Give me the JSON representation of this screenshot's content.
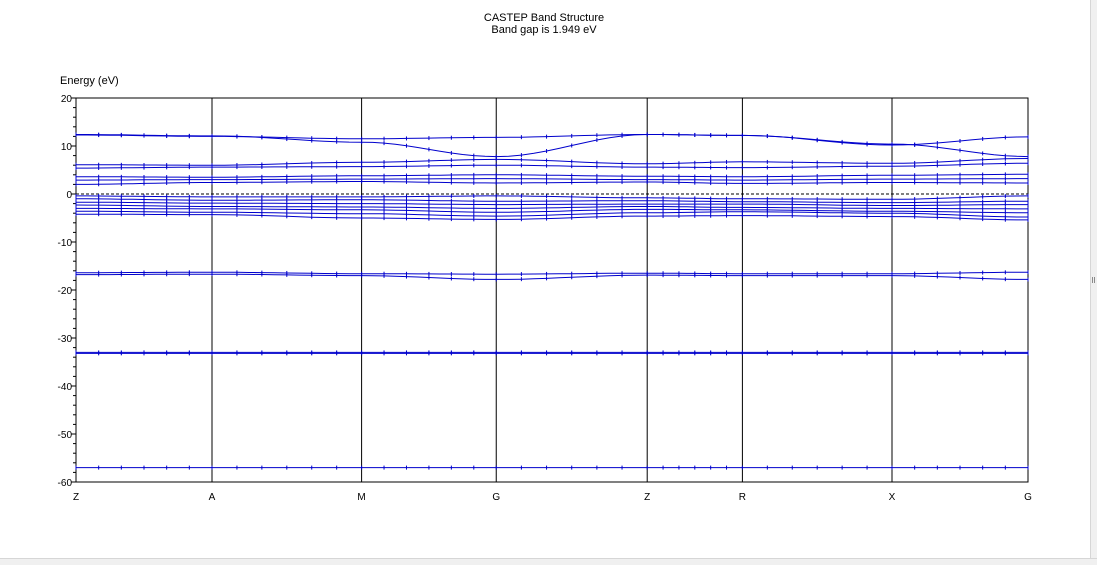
{
  "chart_data": {
    "type": "line",
    "title": "CASTEP Band Structure",
    "subtitle": "Band gap is 1.949 eV",
    "ylabel": "Energy (eV)",
    "xlabel": "",
    "ylim": [
      -60,
      20
    ],
    "yticks": [
      20,
      10,
      0,
      -10,
      -20,
      -30,
      -40,
      -50,
      -60
    ],
    "kpath": [
      "Z",
      "A",
      "M",
      "G",
      "Z",
      "R",
      "X",
      "G"
    ],
    "kpath_positions": [
      0,
      1.0,
      2.1,
      3.09,
      4.2,
      4.9,
      6.0,
      7.0
    ],
    "fermi_level": 0,
    "grid": "vertical lines at high-symmetry points",
    "line_color": "#0000cc",
    "series": [
      {
        "values": [
          -57.0,
          -57.0,
          -57.0,
          -57.0,
          -57.0,
          -57.0,
          -57.0,
          -57.0
        ]
      },
      {
        "values": [
          -33.0,
          -33.0,
          -33.0,
          -33.0,
          -33.0,
          -33.0,
          -33.0,
          -33.0
        ]
      },
      {
        "values": [
          -33.2,
          -33.2,
          -33.2,
          -33.2,
          -33.2,
          -33.2,
          -33.2,
          -33.2
        ]
      },
      {
        "values": [
          -16.4,
          -16.3,
          -16.6,
          -16.7,
          -16.5,
          -16.6,
          -16.6,
          -16.3
        ]
      },
      {
        "values": [
          -16.8,
          -16.7,
          -17.0,
          -17.8,
          -16.9,
          -17.0,
          -17.0,
          -17.8
        ]
      },
      {
        "values": [
          -4.2,
          -4.3,
          -5.0,
          -5.3,
          -4.6,
          -4.5,
          -4.7,
          -5.4
        ]
      },
      {
        "values": [
          -3.6,
          -3.8,
          -4.1,
          -4.6,
          -3.9,
          -3.7,
          -4.0,
          -4.8
        ]
      },
      {
        "values": [
          -3.0,
          -3.1,
          -3.3,
          -3.8,
          -3.2,
          -3.3,
          -3.6,
          -3.9
        ]
      },
      {
        "values": [
          -2.3,
          -2.6,
          -2.7,
          -3.0,
          -2.6,
          -2.8,
          -3.0,
          -3.1
        ]
      },
      {
        "values": [
          -1.7,
          -1.9,
          -2.0,
          -2.2,
          -2.1,
          -2.1,
          -2.4,
          -2.2
        ]
      },
      {
        "values": [
          -1.0,
          -1.3,
          -1.2,
          -1.5,
          -1.4,
          -1.6,
          -1.8,
          -1.5
        ]
      },
      {
        "values": [
          -0.4,
          -0.6,
          -0.6,
          -0.4,
          -0.8,
          -1.0,
          -1.1,
          -0.4
        ]
      },
      {
        "values": [
          2.0,
          2.4,
          2.6,
          2.3,
          2.5,
          2.2,
          2.4,
          2.3
        ]
      },
      {
        "values": [
          2.9,
          3.0,
          3.1,
          3.2,
          3.0,
          2.9,
          3.1,
          3.2
        ]
      },
      {
        "values": [
          3.6,
          3.5,
          3.8,
          4.0,
          3.7,
          3.6,
          3.9,
          4.1
        ]
      },
      {
        "values": [
          5.4,
          5.6,
          5.7,
          6.0,
          5.6,
          5.5,
          5.8,
          6.4
        ]
      },
      {
        "values": [
          6.1,
          6.0,
          6.6,
          7.2,
          6.3,
          6.7,
          6.4,
          7.4
        ]
      },
      {
        "values": [
          12.3,
          12.0,
          11.5,
          11.8,
          12.4,
          12.2,
          10.2,
          11.9
        ]
      },
      {
        "values": [
          12.4,
          12.1,
          10.8,
          7.8,
          12.4,
          12.2,
          10.4,
          7.8
        ]
      }
    ]
  },
  "window": {
    "scrollbar_color": "#f0f0f0"
  }
}
